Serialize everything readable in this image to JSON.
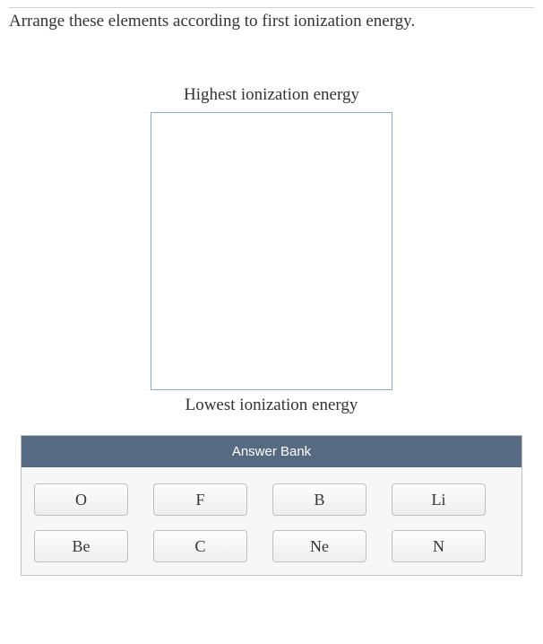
{
  "question": "Arrange these elements according to first ionization energy.",
  "labels": {
    "top": "Highest ionization energy",
    "bottom": "Lowest ionization energy"
  },
  "answerBank": {
    "header": "Answer Bank",
    "items": [
      "O",
      "F",
      "B",
      "Li",
      "Be",
      "C",
      "Ne",
      "N"
    ]
  }
}
